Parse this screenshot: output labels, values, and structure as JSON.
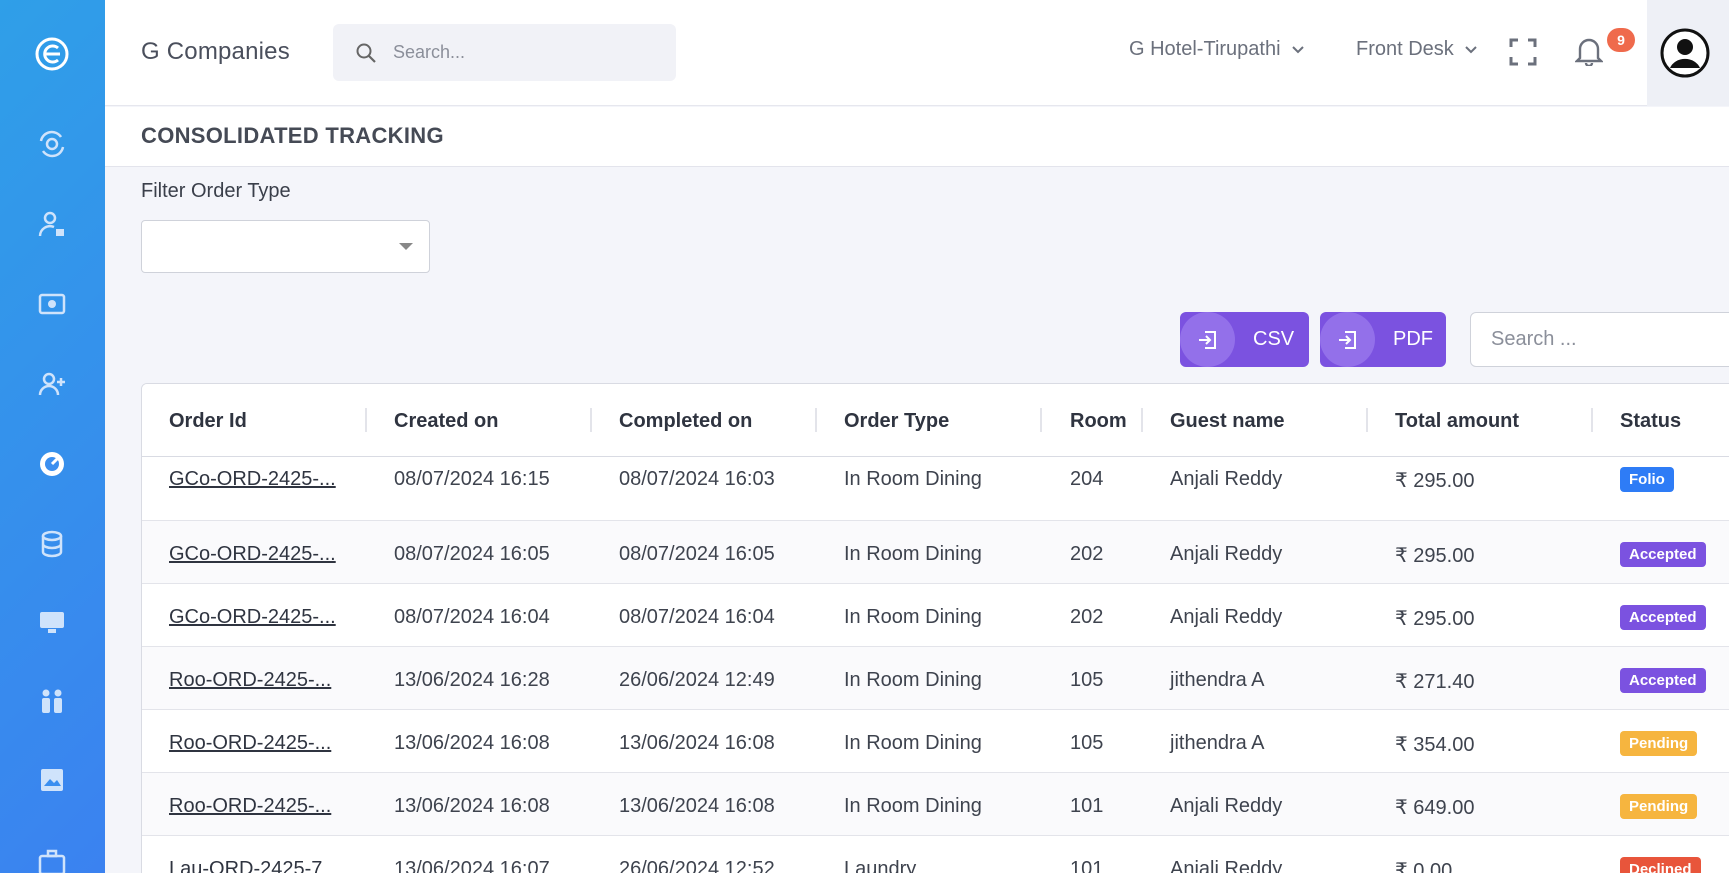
{
  "header": {
    "brand": "G Companies",
    "search_placeholder": "Search...",
    "hotel": "G Hotel-Tirupathi",
    "department": "Front Desk",
    "notification_count": "9"
  },
  "page": {
    "title": "CONSOLIDATED TRACKING",
    "filter_label": "Filter Order Type",
    "csv_label": "CSV",
    "pdf_label": "PDF",
    "table_search_placeholder": "Search ..."
  },
  "table": {
    "columns": [
      "Order Id",
      "Created on",
      "Completed on",
      "Order Type",
      "Room",
      "Guest name",
      "Total amount",
      "Status"
    ],
    "rows": [
      {
        "order_id": "GCo-ORD-2425-...",
        "created": "08/07/2024 16:15",
        "completed": "08/07/2024 16:03",
        "type": "In Room Dining",
        "room": "204",
        "guest": "Anjali Reddy",
        "amount": "₹ 295.00",
        "status": "Folio"
      },
      {
        "order_id": "GCo-ORD-2425-...",
        "created": "08/07/2024 16:05",
        "completed": "08/07/2024 16:05",
        "type": "In Room Dining",
        "room": "202",
        "guest": "Anjali Reddy",
        "amount": "₹ 295.00",
        "status": "Accepted"
      },
      {
        "order_id": "GCo-ORD-2425-...",
        "created": "08/07/2024 16:04",
        "completed": "08/07/2024 16:04",
        "type": "In Room Dining",
        "room": "202",
        "guest": "Anjali Reddy",
        "amount": "₹ 295.00",
        "status": "Accepted"
      },
      {
        "order_id": "Roo-ORD-2425-...",
        "created": "13/06/2024 16:28",
        "completed": "26/06/2024 12:49",
        "type": "In Room Dining",
        "room": "105",
        "guest": "jithendra A",
        "amount": "₹ 271.40",
        "status": "Accepted"
      },
      {
        "order_id": "Roo-ORD-2425-...",
        "created": "13/06/2024 16:08",
        "completed": "13/06/2024 16:08",
        "type": "In Room Dining",
        "room": "105",
        "guest": "jithendra A",
        "amount": "₹ 354.00",
        "status": "Pending"
      },
      {
        "order_id": "Roo-ORD-2425-...",
        "created": "13/06/2024 16:08",
        "completed": "13/06/2024 16:08",
        "type": "In Room Dining",
        "room": "101",
        "guest": "Anjali Reddy",
        "amount": "₹ 649.00",
        "status": "Pending"
      },
      {
        "order_id": "Lau-ORD-2425-7",
        "created": "13/06/2024 16:07",
        "completed": "26/06/2024 12:52",
        "type": "Laundry",
        "room": "101",
        "guest": "Anjali Reddy",
        "amount": "₹ 0.00",
        "status": "Declined"
      }
    ]
  },
  "status_colors": {
    "Folio": "#2e7cf6",
    "Accepted": "#7b52e0",
    "Pending": "#f6b53f",
    "Declined": "#e8553b"
  },
  "sidebar": {
    "icons": [
      "logo-icon",
      "orbit-icon",
      "user-lock-icon",
      "camera-icon",
      "user-plus-icon",
      "gauge-icon",
      "database-icon",
      "monitor-icon",
      "people-icon",
      "image-icon",
      "briefcase-icon"
    ]
  }
}
